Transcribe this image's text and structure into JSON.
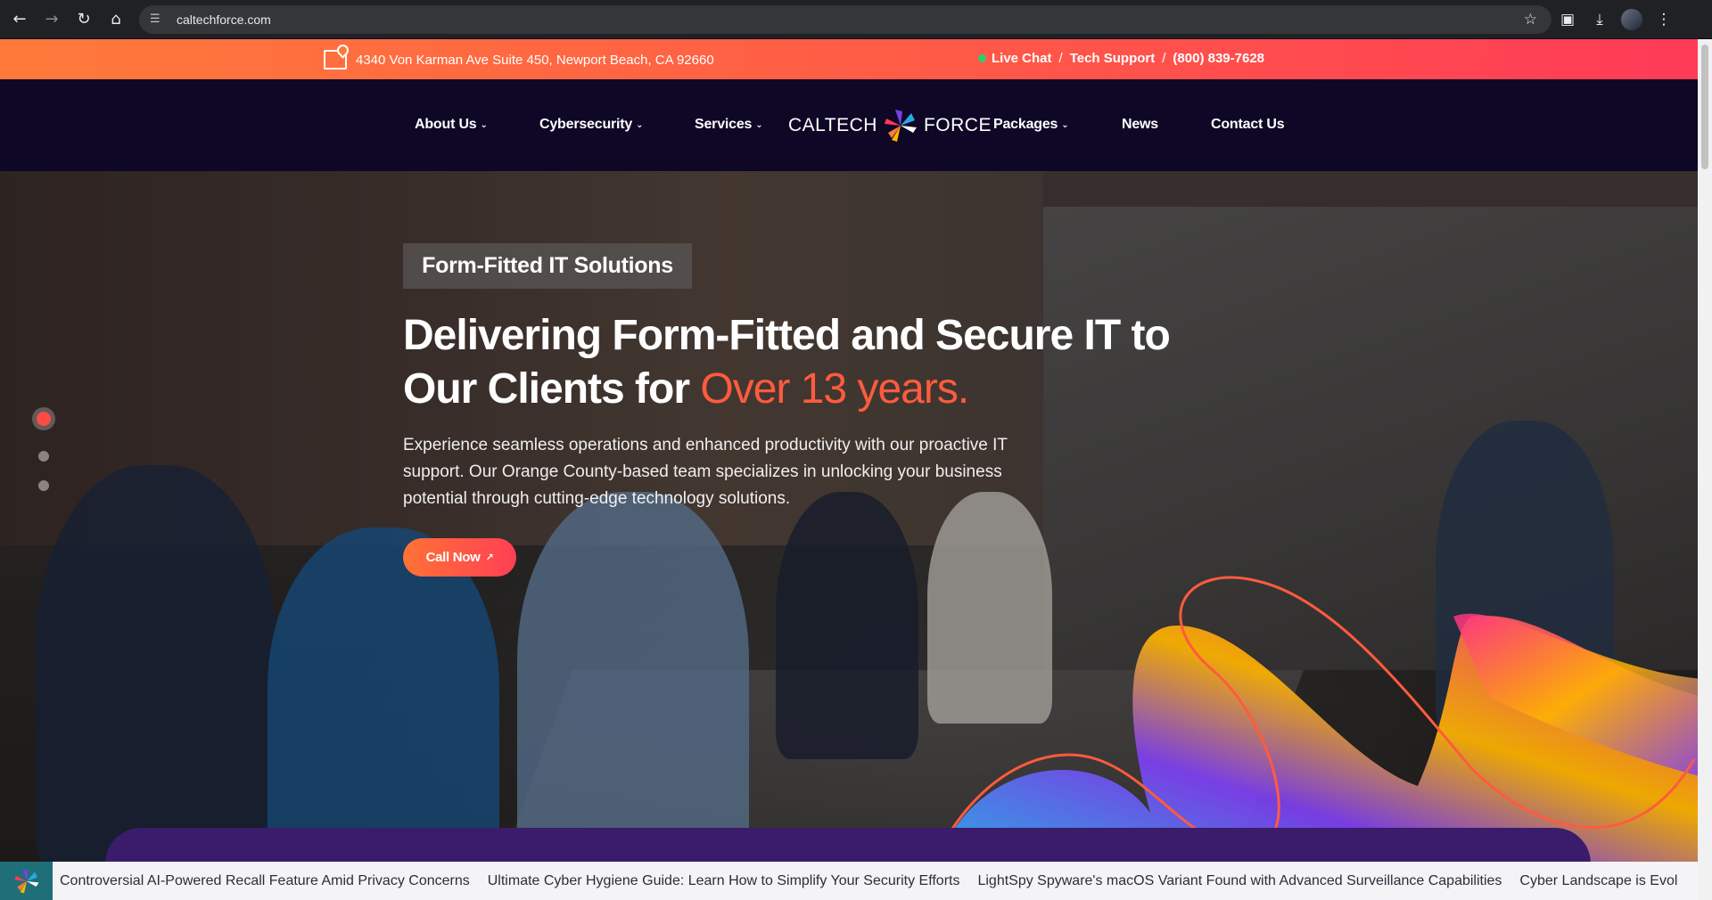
{
  "browser": {
    "url": "caltechforce.com",
    "back_icon": "←",
    "forward_icon": "→",
    "reload_icon": "↻",
    "home_icon": "⌂",
    "star_icon": "☆",
    "extensions_icon": "▣",
    "download_icon": "⤓",
    "menu_icon": "⋮",
    "tune_icon": "☰"
  },
  "topbar": {
    "address": "4340 Von Karman Ave Suite 450, Newport Beach, CA 92660",
    "live_chat": "Live Chat",
    "separator": "/",
    "tech_support": "Tech Support",
    "phone": "(800) 839-7628"
  },
  "nav": {
    "about": "About Us",
    "cybersecurity": "Cybersecurity",
    "services": "Services",
    "packages": "Packages",
    "news": "News",
    "contact": "Contact Us",
    "caret": "⌄",
    "logo_left": "CALTECH",
    "logo_right": "FORCE"
  },
  "hero": {
    "tag": "Form-Fitted IT Solutions",
    "headline_main": "Delivering Form-Fitted and Secure IT to Our Clients for ",
    "headline_accent": "Over 13 years.",
    "subtext": "Experience seamless operations and enhanced productivity with our proactive IT support. Our Orange County-based team specializes in unlocking your business potential through cutting-edge technology solutions.",
    "cta": "Call Now",
    "cta_arrow": "↗",
    "slides": 3,
    "active_slide": 1
  },
  "ticker": {
    "items": [
      "Controversial AI-Powered Recall Feature Amid Privacy Concerns",
      "Ultimate Cyber Hygiene Guide: Learn How to Simplify Your Security Efforts",
      "LightSpy Spyware's macOS Variant Found with Advanced Surveillance Capabilities",
      "Cyber Landscape is Evol"
    ]
  },
  "colors": {
    "nav_bg": "#0e0726",
    "accent_orange": "#ff7a3a",
    "accent_red": "#ff3a57",
    "panel_purple": "#3a1c6b"
  }
}
